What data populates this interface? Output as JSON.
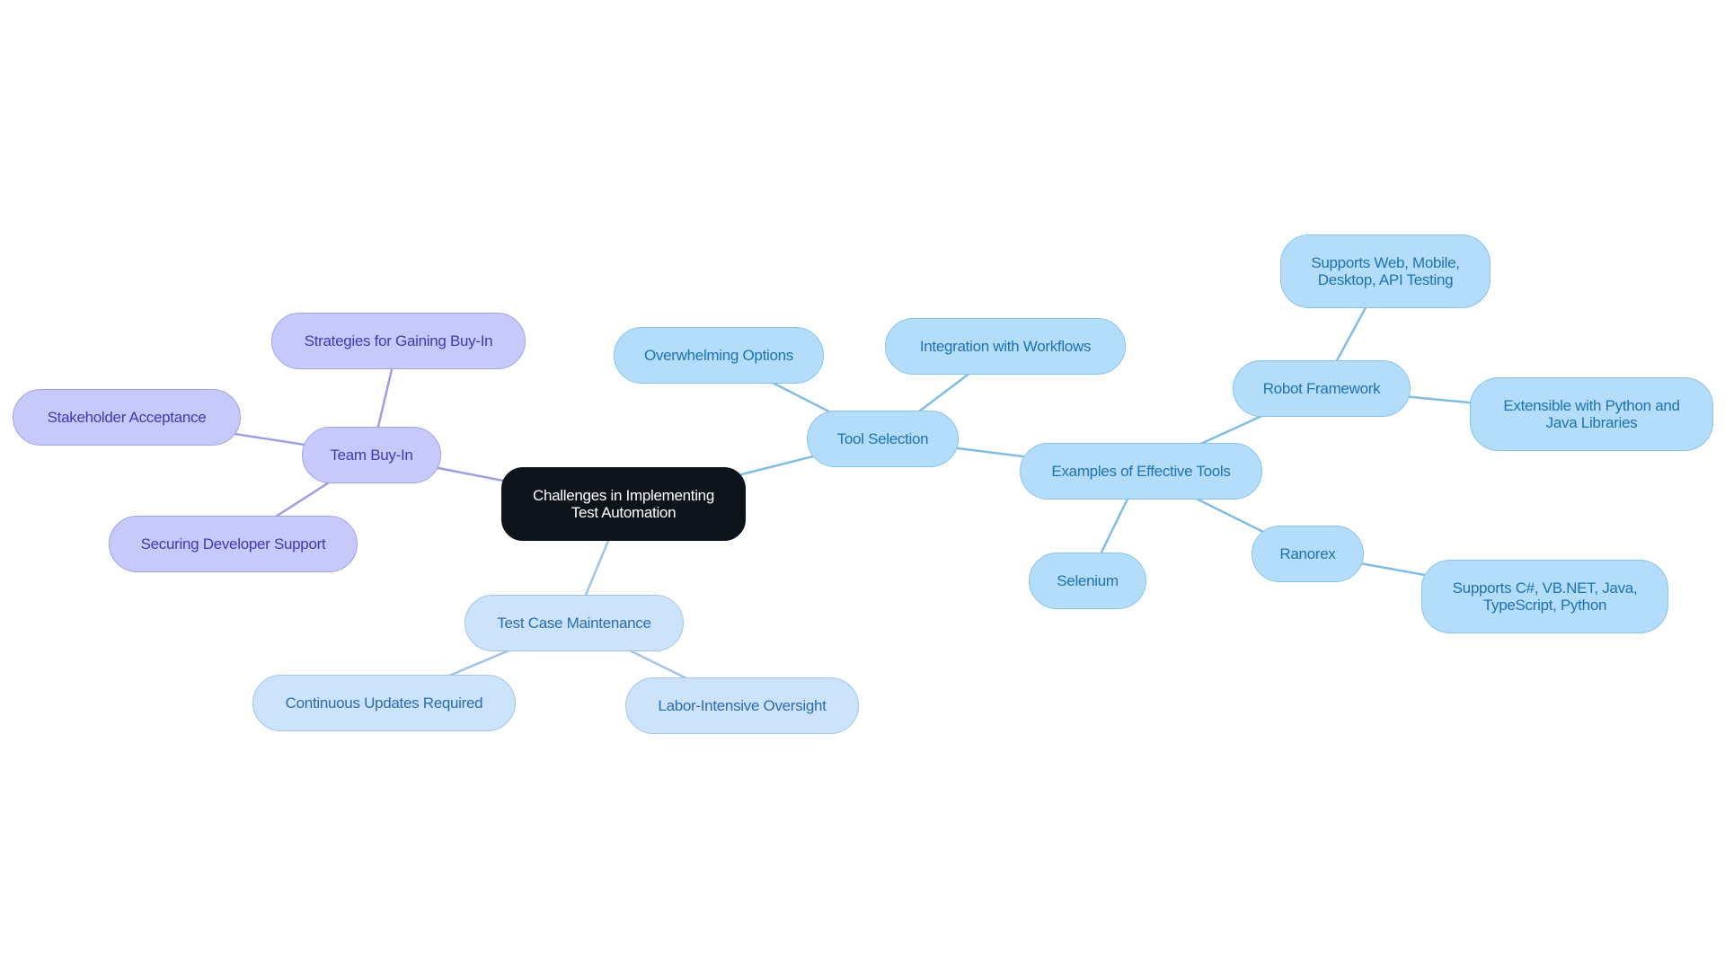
{
  "diagram": {
    "type": "mindmap",
    "colors": {
      "root_fill": "#0e141b",
      "root_text": "#ffffff",
      "purple_fill": "#c8c9fb",
      "purple_text": "#3b3bb3",
      "purple_edge": "#9d9fe0",
      "pale_fill": "#cce3fb",
      "pale_text": "#2b6cb0",
      "pale_edge": "#9fc3ec",
      "blue_fill": "#b3ddfb",
      "blue_text": "#1f72b0",
      "blue_edge": "#7fbde3"
    },
    "nodes": {
      "root": "Challenges in Implementing\nTest Automation",
      "team_buy_in": "Team Buy-In",
      "strategies": "Strategies for Gaining Buy-In",
      "stakeholder": "Stakeholder Acceptance",
      "securing_dev": "Securing Developer Support",
      "test_case_maint": "Test Case Maintenance",
      "continuous_updates": "Continuous Updates Required",
      "labor_intensive": "Labor-Intensive Oversight",
      "tool_selection": "Tool Selection",
      "overwhelming": "Overwhelming Options",
      "integration": "Integration with Workflows",
      "examples": "Examples of Effective Tools",
      "robot": "Robot Framework",
      "robot_supports": "Supports Web, Mobile,\nDesktop, API Testing",
      "robot_extensible": "Extensible with Python and\nJava Libraries",
      "selenium": "Selenium",
      "ranorex": "Ranorex",
      "ranorex_supports": "Supports C#, VB.NET, Java,\nTypeScript, Python"
    },
    "edges": [
      [
        "root",
        "team_buy_in",
        "purple"
      ],
      [
        "team_buy_in",
        "strategies",
        "purple"
      ],
      [
        "team_buy_in",
        "stakeholder",
        "purple"
      ],
      [
        "team_buy_in",
        "securing_dev",
        "purple"
      ],
      [
        "root",
        "test_case_maint",
        "pale"
      ],
      [
        "test_case_maint",
        "continuous_updates",
        "pale"
      ],
      [
        "test_case_maint",
        "labor_intensive",
        "pale"
      ],
      [
        "root",
        "tool_selection",
        "blue"
      ],
      [
        "tool_selection",
        "overwhelming",
        "blue"
      ],
      [
        "tool_selection",
        "integration",
        "blue"
      ],
      [
        "tool_selection",
        "examples",
        "blue"
      ],
      [
        "examples",
        "robot",
        "blue"
      ],
      [
        "robot",
        "robot_supports",
        "blue"
      ],
      [
        "robot",
        "robot_extensible",
        "blue"
      ],
      [
        "examples",
        "selenium",
        "blue"
      ],
      [
        "examples",
        "ranorex",
        "blue"
      ],
      [
        "ranorex",
        "ranorex_supports",
        "blue"
      ]
    ]
  }
}
